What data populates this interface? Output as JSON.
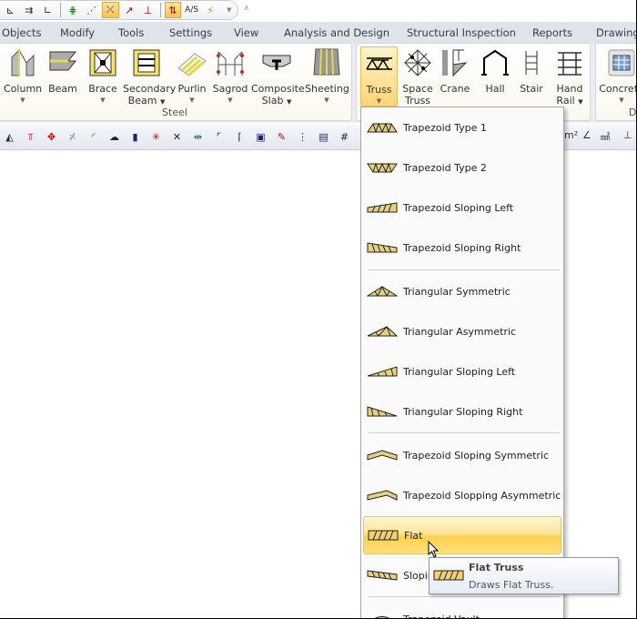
{
  "quick_access": {
    "icons": [
      "snap-end-icon",
      "snap-parallel-icon",
      "snap-perpendicular-icon",
      "snap-grid-lock-icon",
      "snap-node-lock-icon",
      "snap-intersection-lock-icon",
      "snap-midpoint-icon",
      "snap-point-icon",
      "ortho-icon",
      "a-s-icon",
      "lightning-icon"
    ],
    "as_label": "A/S"
  },
  "tabs": [
    "Objects",
    "Modify",
    "Tools",
    "Settings",
    "View",
    "Analysis and Design",
    "Structural Inspection",
    "Reports",
    "Drawings"
  ],
  "ribbon": {
    "steel_group": "Steel",
    "steel_buttons": [
      {
        "label": "Column",
        "dropdown": true
      },
      {
        "label": "Beam",
        "dropdown": false
      },
      {
        "label": "Brace",
        "dropdown": true
      },
      {
        "label": "Secondary\nBeam",
        "l1": "Secondary",
        "l2": "Beam",
        "dropdown": true
      },
      {
        "label": "Purlin",
        "dropdown": true
      },
      {
        "label": "Sagrod",
        "dropdown": true
      },
      {
        "label": "Composite\nSlab",
        "l1": "Composite",
        "l2": "Slab",
        "dropdown": true
      },
      {
        "label": "Sheeting",
        "dropdown": true
      }
    ],
    "truss_buttons": [
      {
        "label": "Truss",
        "dropdown": true,
        "active": true
      },
      {
        "label": "Space\nTruss",
        "l1": "Space",
        "l2": "Truss"
      },
      {
        "label": "Crane"
      },
      {
        "label": "Hall"
      },
      {
        "label": "Stair"
      },
      {
        "label": "Hand\nRail",
        "l1": "Hand",
        "l2": "Rail",
        "dropdown": true
      }
    ],
    "concrete_button": "Concrete",
    "de_group": "De"
  },
  "truss_menu": {
    "items": [
      "Trapezoid Type 1",
      "Trapezoid Type 2",
      "Trapezoid Sloping Left",
      "Trapezoid Sloping Right",
      "Triangular Symmetric",
      "Triangular Asymmetric",
      "Triangular Sloping Left",
      "Triangular Sloping Right",
      "Trapezoid Sloping Symmetric",
      "Trapezoid Slopping Asymmetric",
      "Flat",
      "Sloping",
      "Trapezoid Vault"
    ],
    "highlighted": "Flat"
  },
  "tooltip": {
    "title": "Flat Truss",
    "description": "Draws Flat Truss."
  },
  "colors": {
    "highlight": "#fbd14e",
    "accent": "#f8c25b",
    "tab_bg": "#dfe4ec"
  }
}
